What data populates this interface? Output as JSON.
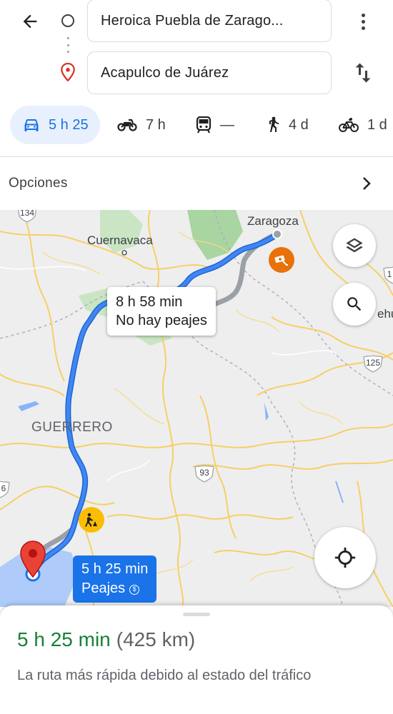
{
  "search": {
    "origin": "Heroica Puebla de Zarago...",
    "destination": "Acapulco de Juárez"
  },
  "modes": [
    {
      "icon": "car-icon",
      "label": "5 h 25",
      "selected": true
    },
    {
      "icon": "motorcycle-icon",
      "label": "7 h"
    },
    {
      "icon": "transit-icon",
      "label": "—"
    },
    {
      "icon": "walk-icon",
      "label": "4 d"
    },
    {
      "icon": "bike-icon",
      "label": "1 d"
    }
  ],
  "options_label": "Opciones",
  "map": {
    "labels": {
      "zaragoza": "Zaragoza",
      "cuernavaca": "Cuernavaca",
      "guerrero": "GUERRERO",
      "edge_right": "ehu"
    },
    "shields": {
      "r134": "134",
      "r125": "125",
      "r93": "93",
      "r1": "1",
      "r6": "6"
    },
    "alt_route": {
      "time": "8 h 58 min",
      "tolls": "No hay peajes"
    },
    "main_route": {
      "time": "5 h 25 min",
      "tolls": "Peajes"
    },
    "colors": {
      "route": "#1a73e8",
      "alt_route": "#9aa0a6",
      "pin": "#ea4335"
    }
  },
  "summary": {
    "duration": "5 h 25 min",
    "distance": "(425 km)",
    "reason": "La ruta más rápida debido al estado del tráfico"
  }
}
